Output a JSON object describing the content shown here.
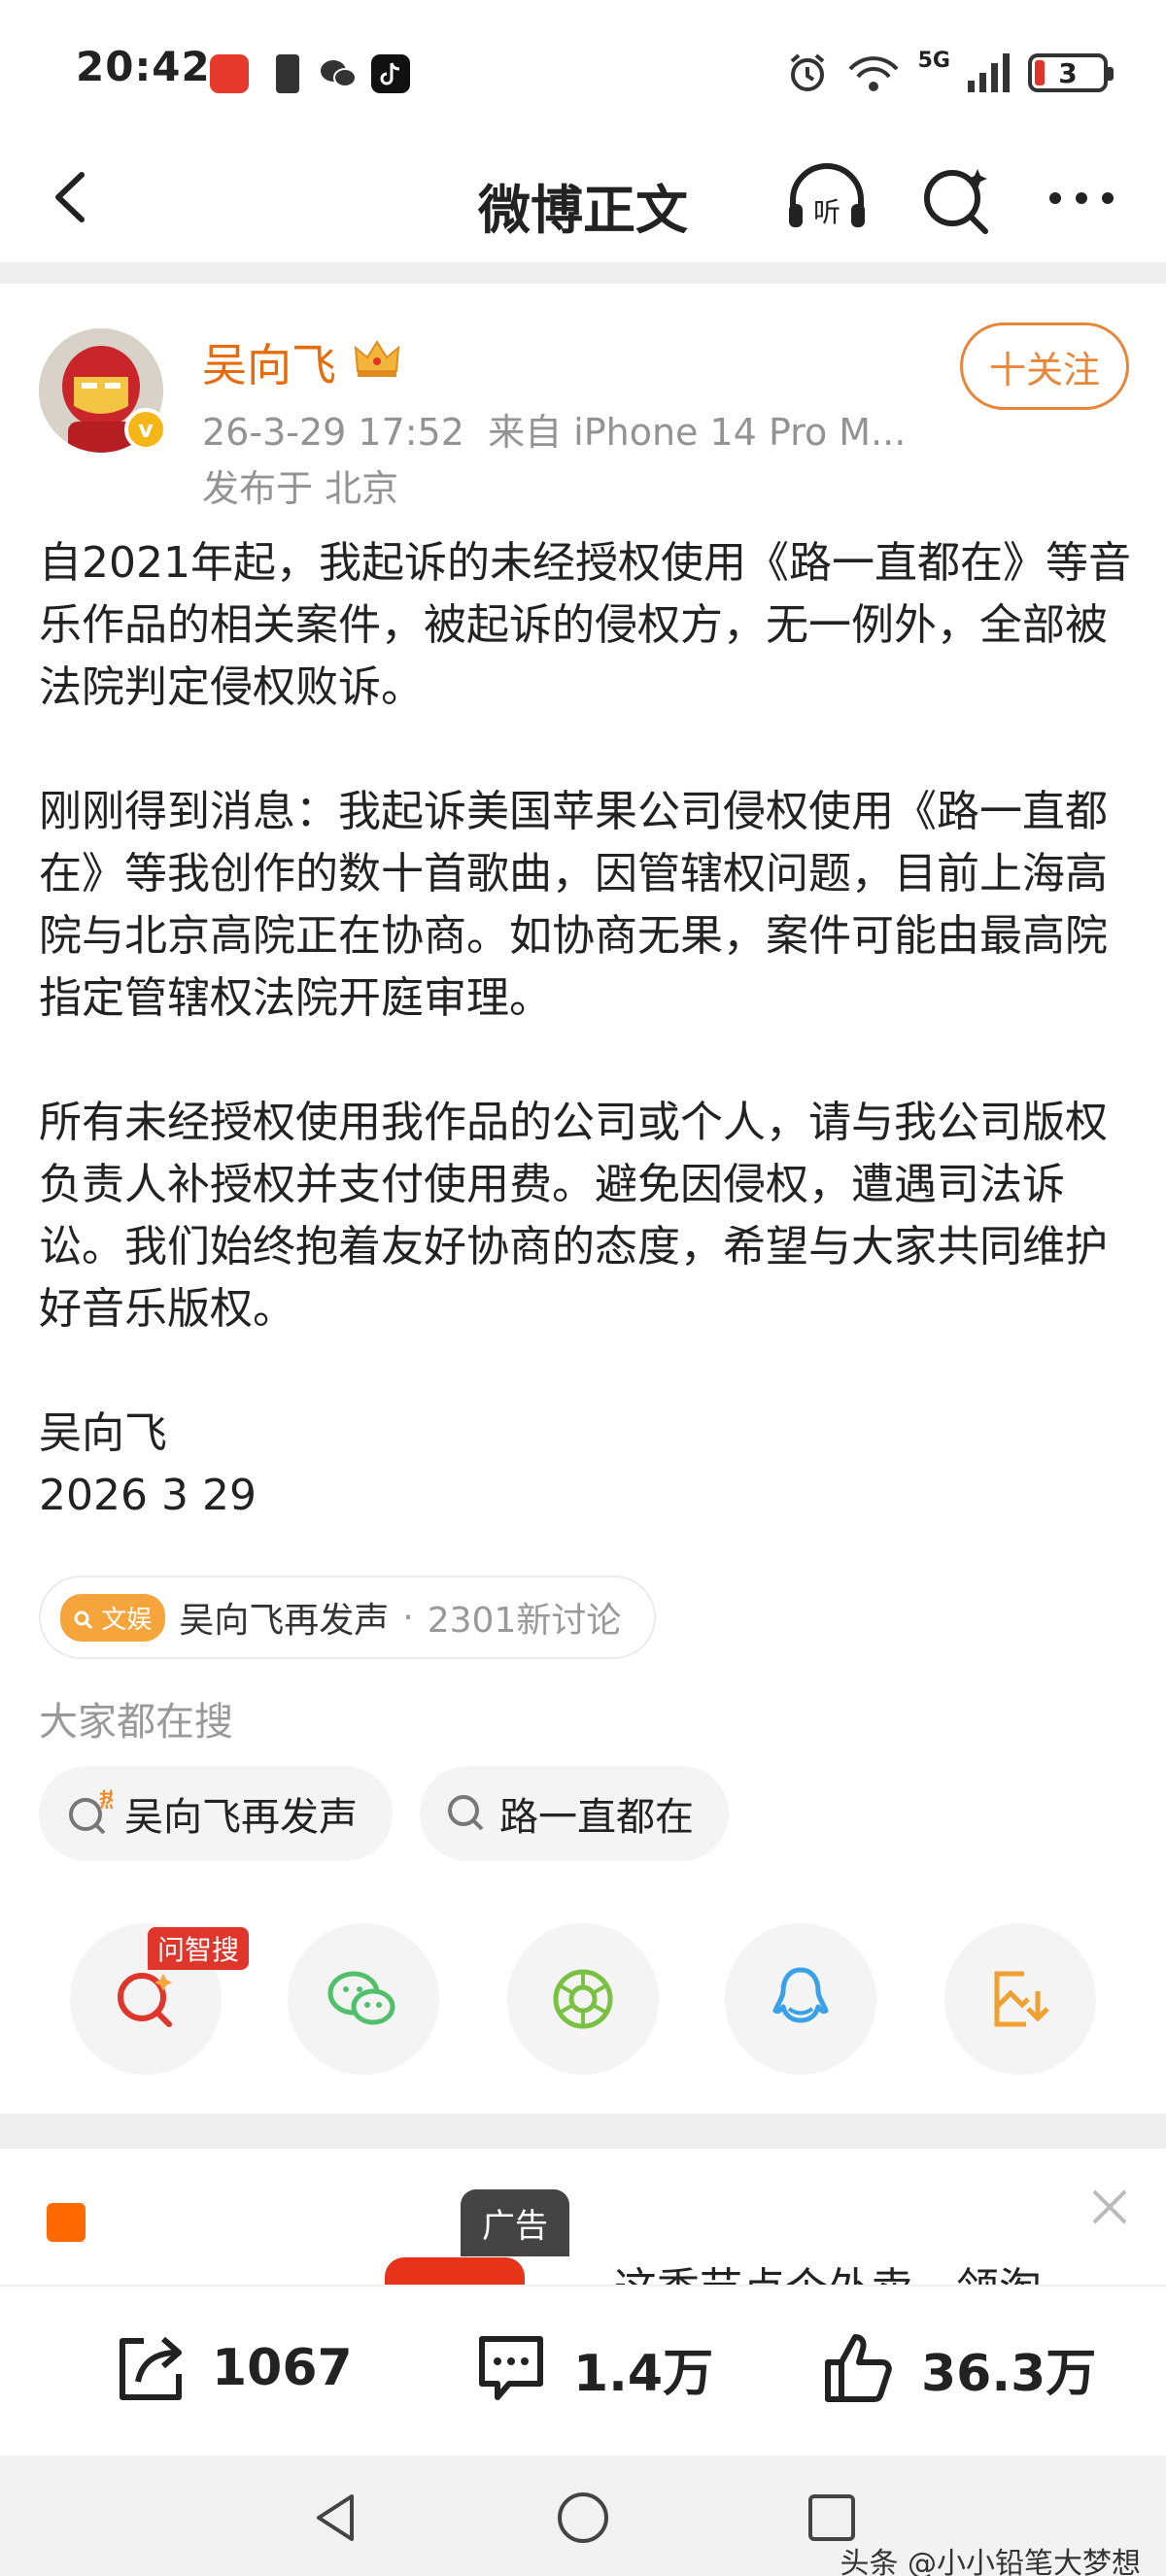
{
  "status_bar": {
    "time": "20:42",
    "network": "5G",
    "battery": "3"
  },
  "nav": {
    "title": "微博正文",
    "listen_label": "听"
  },
  "post": {
    "author": "吴向飞",
    "timestamp": "26-3-29 17:52",
    "source": "来自 iPhone 14 Pro M...",
    "location": "发布于 北京",
    "follow_label": "十关注",
    "paragraphs": [
      "自2021年起，我起诉的未经授权使用《路一直都在》等音乐作品的相关案件，被起诉的侵权方，无一例外，全部被法院判定侵权败诉。",
      "刚刚得到消息：我起诉美国苹果公司侵权使用《路一直都在》等我创作的数十首歌曲，因管辖权问题，目前上海高院与北京高院正在协商。如协商无果，案件可能由最高院指定管辖权法院开庭审理。",
      "所有未经授权使用我作品的公司或个人，请与我公司版权负责人补授权并支付使用费。避免因侵权，遭遇司法诉讼。我们始终抱着友好协商的态度，希望与大家共同维护好音乐版权。"
    ],
    "signature": "吴向飞",
    "date": "2026 3 29"
  },
  "topic": {
    "tag": "文娱",
    "title": "吴向飞再发声",
    "separator": "·",
    "count": "2301新讨论"
  },
  "search": {
    "heading": "大家都在搜",
    "chips": [
      "吴向飞再发声",
      "路一直都在"
    ],
    "hot_mark": "热"
  },
  "share": {
    "ask_badge": "问智搜",
    "icons": [
      "ask-search-icon",
      "wechat-icon",
      "moments-icon",
      "qq-icon",
      "save-image-icon"
    ]
  },
  "ad": {
    "label": "广告",
    "text": "这季节点个外卖，领淘"
  },
  "actions": {
    "repost": "1067",
    "comments": "1.4万",
    "likes": "36.3万"
  },
  "watermark": "头条 @小小铅笔大梦想",
  "colors": {
    "accent_orange": "#e86b0b",
    "follow_orange": "#e8863a",
    "topic_tag": "#f5a53c",
    "badge_red": "#e0352b",
    "wechat_green": "#52c06b",
    "qq_blue": "#3aa0e8",
    "save_orange": "#f0a030"
  }
}
